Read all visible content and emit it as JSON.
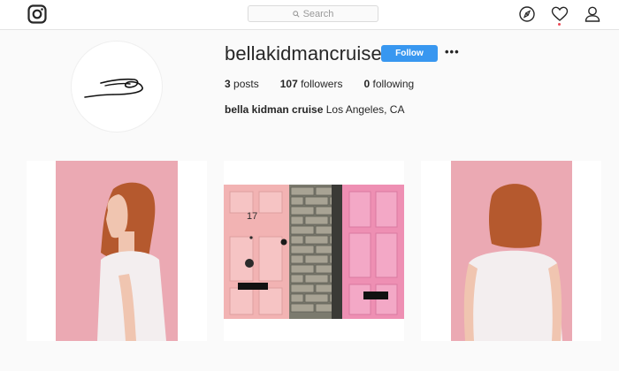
{
  "header": {
    "logo_icon": "instagram-camera-icon",
    "search": {
      "placeholder": "Search",
      "icon": "search-icon"
    },
    "nav_icons": [
      "compass-icon",
      "heart-icon",
      "profile-icon"
    ],
    "has_notification": true
  },
  "profile": {
    "username": "bellakidmancruise",
    "follow_label": "Follow",
    "more_label": "•••",
    "stats": {
      "posts_count": "3",
      "posts_label": "posts",
      "followers_count": "107",
      "followers_label": "followers",
      "following_count": "0",
      "following_label": "following"
    },
    "full_name": "bella kidman cruise",
    "location": "Los Angeles, CA"
  },
  "posts": [
    {
      "alt": "woman-profile-pink-background"
    },
    {
      "door_number": "17"
    },
    {
      "alt": "woman-back-pink-background"
    }
  ],
  "colors": {
    "accent": "#3897f0",
    "pink_background": "#eba9b3",
    "door_pink": "#f2b3b3"
  }
}
